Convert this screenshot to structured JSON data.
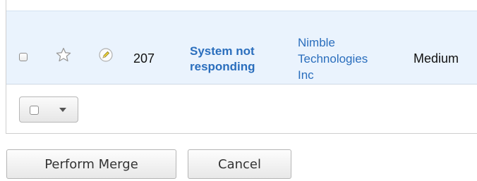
{
  "record_row": {
    "number": "207",
    "subject": "System not\nresponding",
    "account": "Nimble\nTechnologies\nInc",
    "priority": "Medium"
  },
  "icons": {
    "row_checkbox": "checkbox-icon",
    "favorite": "star-outline-icon",
    "edit": "pencil-icon",
    "mass_select": "checkbox-dropdown-icon",
    "caret": "caret-down-icon"
  },
  "actions": {
    "perform_merge": "Perform Merge",
    "cancel": "Cancel"
  },
  "colors": {
    "row_highlight": "#eaf3fd",
    "link": "#2a6ebd",
    "pencil_accent": "#f0d43a"
  }
}
